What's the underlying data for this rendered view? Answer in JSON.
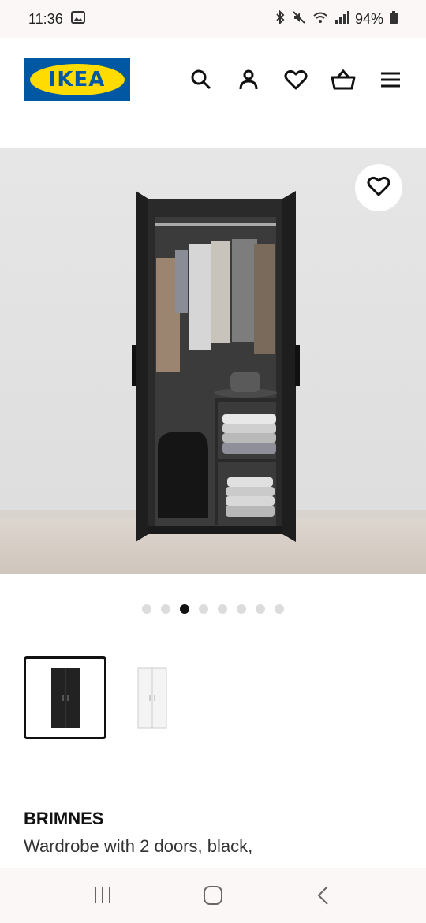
{
  "status": {
    "time": "11:36",
    "battery": "94%"
  },
  "header": {
    "logo_text": "IKEA",
    "icons": [
      "search-icon",
      "account-icon",
      "heart-icon",
      "basket-icon",
      "menu-icon"
    ]
  },
  "gallery": {
    "image_count": 8,
    "active_index": 2,
    "variants": [
      "black",
      "white"
    ],
    "selected_variant": 0
  },
  "product": {
    "name": "BRIMNES",
    "description": "Wardrobe with 2 doors, black,"
  },
  "colors": {
    "ikea_blue": "#0058a3",
    "ikea_yellow": "#ffdb00"
  }
}
